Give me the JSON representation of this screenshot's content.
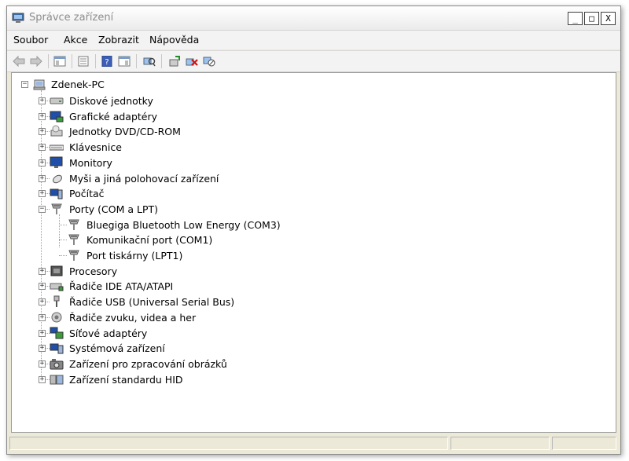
{
  "window": {
    "title": "Správce zařízení"
  },
  "window_buttons": {
    "minimize": "_",
    "maximize": "□",
    "close": "X"
  },
  "menu": {
    "file": "Soubor",
    "action": "Akce",
    "view": "Zobrazit",
    "help": "Nápověda"
  },
  "tree": {
    "root": "Zdenek-PC",
    "categories": [
      {
        "label": "Diskové jednotky",
        "icon": "disk-drive-icon"
      },
      {
        "label": "Grafické adaptéry",
        "icon": "display-adapter-icon"
      },
      {
        "label": "Jednotky DVD/CD-ROM",
        "icon": "dvd-drive-icon"
      },
      {
        "label": "Klávesnice",
        "icon": "keyboard-icon"
      },
      {
        "label": "Monitory",
        "icon": "monitor-icon"
      },
      {
        "label": "Myši a jiná polohovací zařízení",
        "icon": "mouse-icon"
      },
      {
        "label": "Počítač",
        "icon": "computer-icon"
      },
      {
        "label": "Porty (COM a LPT)",
        "icon": "port-icon"
      },
      {
        "label": "Procesory",
        "icon": "processor-icon"
      },
      {
        "label": "Řadiče IDE ATA/ATAPI",
        "icon": "ide-controller-icon"
      },
      {
        "label": "Řadiče USB (Universal Serial Bus)",
        "icon": "usb-icon"
      },
      {
        "label": "Řadiče zvuku, videa a her",
        "icon": "sound-icon"
      },
      {
        "label": "Síťové adaptéry",
        "icon": "network-adapter-icon"
      },
      {
        "label": "Systémová zařízení",
        "icon": "system-device-icon"
      },
      {
        "label": "Zařízení pro zpracování obrázků",
        "icon": "imaging-device-icon"
      },
      {
        "label": "Zařízení standardu HID",
        "icon": "hid-icon"
      }
    ],
    "ports_children": [
      {
        "label": "Bluegiga Bluetooth Low Energy (COM3)",
        "icon": "port-icon"
      },
      {
        "label": "Komunikační port (COM1)",
        "icon": "port-icon"
      },
      {
        "label": "Port tiskárny (LPT1)",
        "icon": "port-icon"
      }
    ]
  },
  "colors": {
    "accent": "#1f5fbf",
    "tree_line": "#a0a0a0"
  }
}
